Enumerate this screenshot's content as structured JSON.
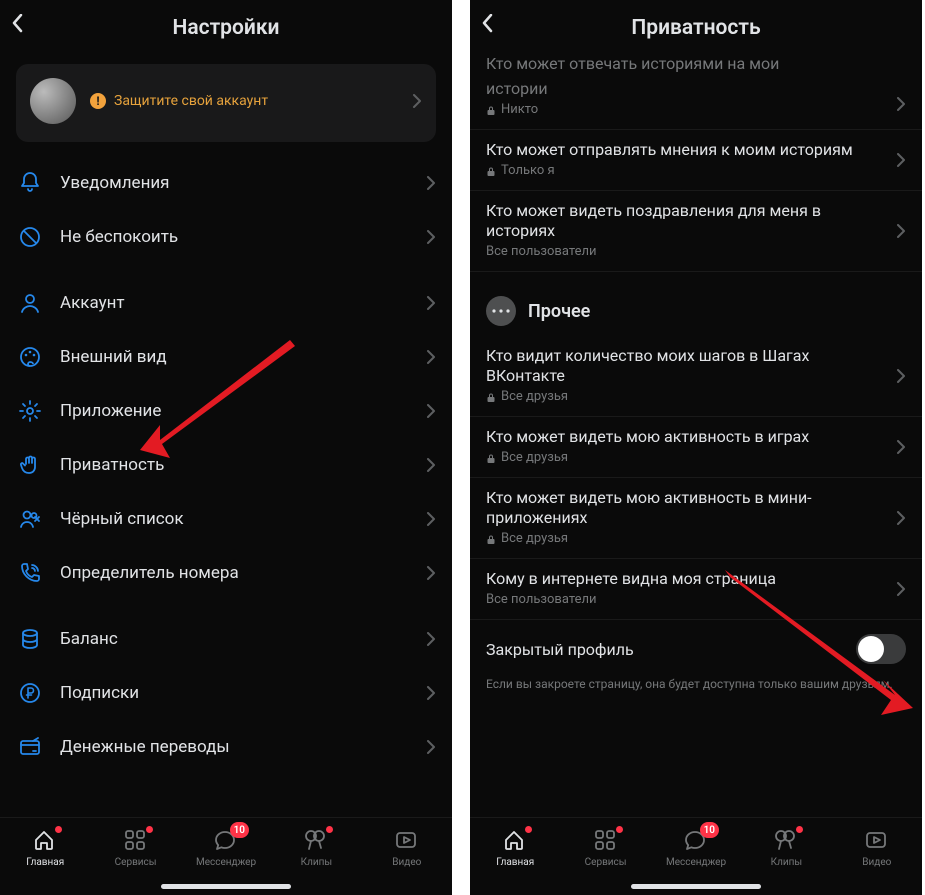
{
  "left": {
    "header": {
      "title": "Настройки"
    },
    "profile": {
      "warning": "Защитите свой аккаунт"
    },
    "group1": [
      {
        "icon": "bell-icon",
        "label": "Уведомления"
      },
      {
        "icon": "nodisturb-icon",
        "label": "Не беспокоить"
      }
    ],
    "group2": [
      {
        "icon": "person-icon",
        "label": "Аккаунт"
      },
      {
        "icon": "palette-icon",
        "label": "Внешний вид"
      },
      {
        "icon": "gear-icon",
        "label": "Приложение"
      },
      {
        "icon": "hand-icon",
        "label": "Приватность"
      },
      {
        "icon": "group-remove-icon",
        "label": "Чёрный список"
      },
      {
        "icon": "caller-id-icon",
        "label": "Определитель номера"
      }
    ],
    "group3": [
      {
        "icon": "database-icon",
        "label": "Баланс"
      },
      {
        "icon": "ruble-icon",
        "label": "Подписки"
      },
      {
        "icon": "card-icon",
        "label": "Денежные переводы"
      }
    ]
  },
  "right": {
    "header": {
      "title": "Приватность"
    },
    "cutoff": {
      "title_line1": "Кто может отвечать историями на мои",
      "title_line2": "истории",
      "sub": "Никто",
      "locked": true
    },
    "rows_a": [
      {
        "title": "Кто может отправлять мнения к моим историям",
        "sub": "Только я",
        "locked": true
      },
      {
        "title": "Кто может видеть поздравления для меня в историях",
        "sub": "Все пользователи",
        "locked": false
      }
    ],
    "section_label": "Прочее",
    "rows_b": [
      {
        "title": "Кто видит количество моих шагов в Шагах ВКонтакте",
        "sub": "Все друзья",
        "locked": true
      },
      {
        "title": "Кто может видеть мою активность в играх",
        "sub": "Все друзья",
        "locked": true
      },
      {
        "title": "Кто может видеть мою активность в мини-приложениях",
        "sub": "Все друзья",
        "locked": true
      },
      {
        "title": "Кому в интернете видна моя страница",
        "sub": "Все пользователи",
        "locked": false
      }
    ],
    "toggle": {
      "label": "Закрытый профиль",
      "on": false
    },
    "hint": "Если вы закроете страницу, она будет доступна только вашим друзьям."
  },
  "tabs": [
    {
      "icon": "home-icon",
      "label": "Главная",
      "active": true,
      "dot": true
    },
    {
      "icon": "services-icon",
      "label": "Сервисы",
      "dot": true
    },
    {
      "icon": "messenger-icon",
      "label": "Мессенджер",
      "badge": "10"
    },
    {
      "icon": "clips-icon",
      "label": "Клипы",
      "dot": true
    },
    {
      "icon": "video-icon",
      "label": "Видео"
    }
  ]
}
